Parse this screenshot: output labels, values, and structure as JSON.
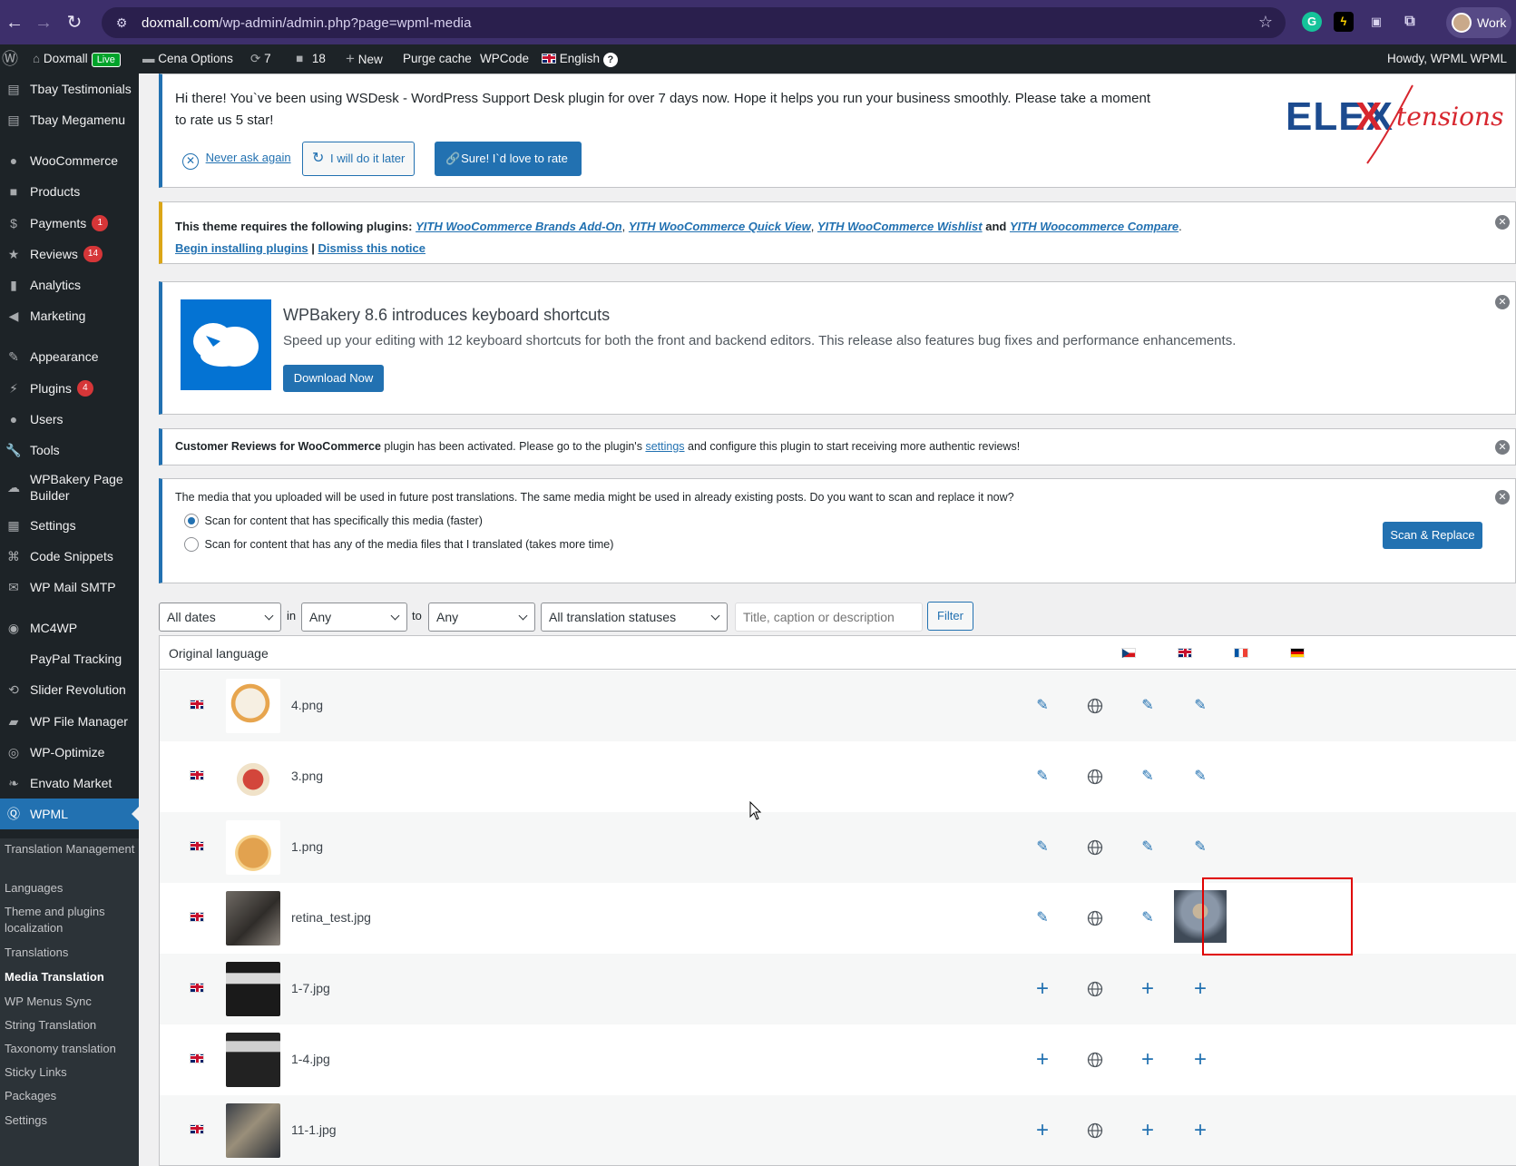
{
  "browser": {
    "url_domain": "doxmall.com",
    "url_path": "/wp-admin/admin.php?page=wpml-media",
    "profile_label": "Work"
  },
  "adminbar": {
    "site_name": "Doxmall",
    "live_label": "Live",
    "theme_options": "Cena Options",
    "updates_count": "7",
    "comments_count": "18",
    "new_label": "New",
    "purge_cache": "Purge cache",
    "wpcode": "WPCode",
    "language": "English",
    "howdy": "Howdy, WPML WPML"
  },
  "sidebar": {
    "items": [
      {
        "label": "Tbay Testimonials",
        "icon": "grid-icon"
      },
      {
        "label": "Tbay Megamenu",
        "icon": "grid-icon"
      },
      {
        "label": "WooCommerce",
        "icon": "woo-icon"
      },
      {
        "label": "Products",
        "icon": "box-icon"
      },
      {
        "label": "Payments",
        "icon": "dollar-icon",
        "badge": "1"
      },
      {
        "label": "Reviews",
        "icon": "star-icon",
        "badge": "14"
      },
      {
        "label": "Analytics",
        "icon": "bar-chart-icon"
      },
      {
        "label": "Marketing",
        "icon": "megaphone-icon"
      },
      {
        "label": "Appearance",
        "icon": "brush-icon"
      },
      {
        "label": "Plugins",
        "icon": "plug-icon",
        "badge": "4"
      },
      {
        "label": "Users",
        "icon": "user-icon"
      },
      {
        "label": "Tools",
        "icon": "wrench-icon"
      },
      {
        "label": "WPBakery Page Builder",
        "icon": "cloud-icon"
      },
      {
        "label": "Settings",
        "icon": "sliders-icon"
      },
      {
        "label": "Code Snippets",
        "icon": "code-icon"
      },
      {
        "label": "WP Mail SMTP",
        "icon": "mail-icon"
      },
      {
        "label": "MC4WP",
        "icon": "mc4wp-icon"
      },
      {
        "label": "PayPal Tracking",
        "icon": ""
      },
      {
        "label": "Slider Revolution",
        "icon": "refresh-icon"
      },
      {
        "label": "WP File Manager",
        "icon": "folder-icon"
      },
      {
        "label": "WP-Optimize",
        "icon": "optimize-icon"
      },
      {
        "label": "Envato Market",
        "icon": "leaf-icon"
      },
      {
        "label": "WPML",
        "icon": "wpml-icon"
      }
    ],
    "submenu": [
      "Translation Management",
      "Languages",
      "Theme and plugins localization",
      "Translations",
      "Media Translation",
      "WP Menus Sync",
      "String Translation",
      "Taxonomy translation",
      "Sticky Links",
      "Packages",
      "Settings"
    ]
  },
  "wsdesk_notice": {
    "text": "Hi there! You`ve been using WSDesk - WordPress Support Desk plugin for over 7 days now. Hope it helps you run your business smoothly. Please take a moment to rate us 5 star!",
    "never_ask": "Never ask again",
    "later": "I will do it later",
    "rate": "Sure! I`d love to rate",
    "logo_main": "ELEX",
    "logo_script": "tensions"
  },
  "theme_notice": {
    "prefix": "This theme requires the following plugins:",
    "plugin1": "YITH WooCommerce Brands Add-On",
    "plugin2": "YITH WooCommerce Quick View",
    "plugin3": "YITH WooCommerce Wishlist",
    "and": "and",
    "plugin4": "YITH Woocommerce Compare",
    "begin_install": "Begin installing plugins",
    "separator": "|",
    "dismiss": "Dismiss this notice"
  },
  "wpbakery_notice": {
    "title": "WPBakery 8.6 introduces keyboard shortcuts",
    "text": "Speed up your editing with 12 keyboard shortcuts for both the front and backend editors. This release also features bug fixes and performance enhancements.",
    "button": "Download Now"
  },
  "reviews_notice": {
    "plugin": "Customer Reviews for WooCommerce",
    "text1": "plugin has been activated. Please go to the plugin's",
    "link": "settings",
    "text2": "and configure this plugin to start receiving more authentic reviews!"
  },
  "media_notice": {
    "text": "The media that you uploaded will be used in future post translations. The same media might be used in already existing posts. Do you want to scan and replace it now?",
    "option1": "Scan for content that has specifically this media (faster)",
    "option2": "Scan for content that has any of the media files that I translated (takes more time)",
    "button": "Scan & Replace"
  },
  "filters": {
    "dates": "All dates",
    "in": "in",
    "lang_from": "Any language",
    "to": "to",
    "lang_to": "Any language",
    "status": "All translation statuses",
    "search_placeholder": "Title, caption or description",
    "filter_button": "Filter"
  },
  "table": {
    "header": "Original language",
    "columns": [
      "cz-flag",
      "uk-flag",
      "fr-flag",
      "de-flag"
    ],
    "rows": [
      {
        "name": "4.png",
        "cells": [
          "edit",
          "globe",
          "edit",
          "edit"
        ]
      },
      {
        "name": "3.png",
        "cells": [
          "edit",
          "globe",
          "edit",
          "edit"
        ]
      },
      {
        "name": "1.png",
        "cells": [
          "edit",
          "globe",
          "edit",
          "edit"
        ]
      },
      {
        "name": "retina_test.jpg",
        "cells": [
          "edit",
          "globe",
          "edit",
          "image"
        ]
      },
      {
        "name": "1-7.jpg",
        "cells": [
          "add",
          "globe",
          "add",
          "add"
        ]
      },
      {
        "name": "1-4.jpg",
        "cells": [
          "add",
          "globe",
          "add",
          "add"
        ]
      },
      {
        "name": "11-1.jpg",
        "cells": [
          "add",
          "globe",
          "add",
          "add"
        ]
      }
    ]
  },
  "colors": {
    "accent": "#2271b1",
    "highlight_box": "#e00000"
  }
}
